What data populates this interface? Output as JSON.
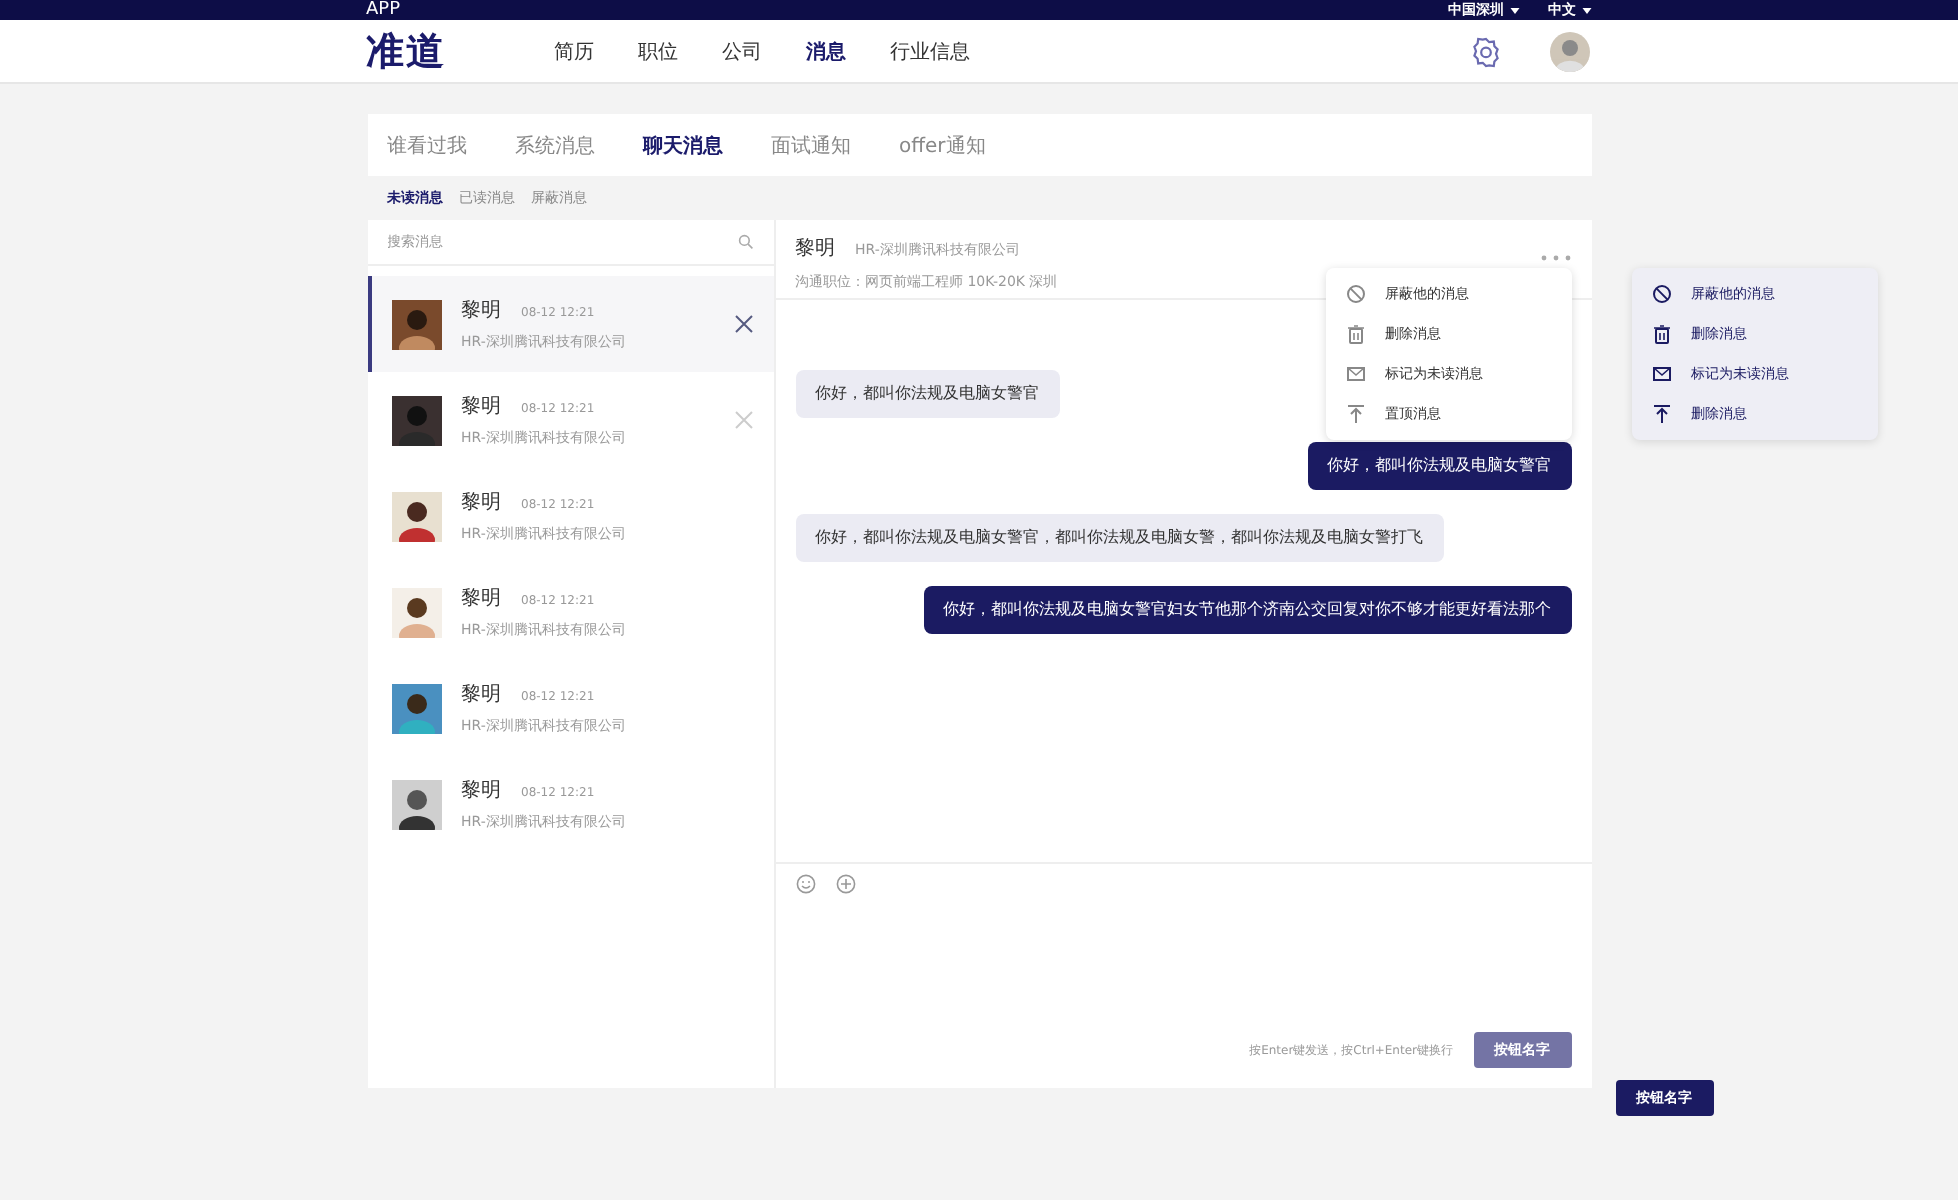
{
  "top_bar": {
    "app_label": "APP",
    "region": "中国深圳",
    "language": "中文"
  },
  "header": {
    "logo": "准道",
    "nav": [
      {
        "label": "简历",
        "selected": false
      },
      {
        "label": "职位",
        "selected": false
      },
      {
        "label": "公司",
        "selected": false
      },
      {
        "label": "消息",
        "selected": true
      },
      {
        "label": "行业信息",
        "selected": false
      }
    ]
  },
  "tabs": [
    {
      "label": "谁看过我",
      "selected": false
    },
    {
      "label": "系统消息",
      "selected": false
    },
    {
      "label": "聊天消息",
      "selected": true
    },
    {
      "label": "面试通知",
      "selected": false
    },
    {
      "label": "offer通知",
      "selected": false
    }
  ],
  "sub_tabs": [
    {
      "label": "未读消息",
      "selected": true
    },
    {
      "label": "已读消息",
      "selected": false
    },
    {
      "label": "屏蔽消息",
      "selected": false
    }
  ],
  "search": {
    "placeholder": "搜索消息"
  },
  "conversations": [
    {
      "name": "黎明",
      "time": "08-12 12:21",
      "company": "HR-深圳腾讯科技有限公司",
      "selected": true,
      "close_visible": true
    },
    {
      "name": "黎明",
      "time": "08-12 12:21",
      "company": "HR-深圳腾讯科技有限公司",
      "selected": false,
      "close_visible": true
    },
    {
      "name": "黎明",
      "time": "08-12 12:21",
      "company": "HR-深圳腾讯科技有限公司",
      "selected": false,
      "close_visible": false
    },
    {
      "name": "黎明",
      "time": "08-12 12:21",
      "company": "HR-深圳腾讯科技有限公司",
      "selected": false,
      "close_visible": false
    },
    {
      "name": "黎明",
      "time": "08-12 12:21",
      "company": "HR-深圳腾讯科技有限公司",
      "selected": false,
      "close_visible": false
    },
    {
      "name": "黎明",
      "time": "08-12 12:21",
      "company": "HR-深圳腾讯科技有限公司",
      "selected": false,
      "close_visible": false
    }
  ],
  "chat": {
    "name": "黎明",
    "company": "HR-深圳腾讯科技有限公司",
    "position": "沟通职位：网页前端工程师 10K-20K 深圳",
    "menu": [
      {
        "label": "屏蔽他的消息",
        "kind": "block"
      },
      {
        "label": "删除消息",
        "kind": "trash"
      },
      {
        "label": "标记为未读消息",
        "kind": "mail"
      },
      {
        "label": "置顶消息",
        "kind": "top"
      }
    ],
    "messages": [
      {
        "text": "你好，都叫你法规及电脑女警官",
        "kind": "received"
      },
      {
        "text": "你好，都叫你法规及电脑女警官",
        "kind": "sent"
      },
      {
        "text": "你好，都叫你法规及电脑女警官，都叫你法规及电脑女警，都叫你法规及电脑女警打飞",
        "kind": "received"
      },
      {
        "text": "你好，都叫你法规及电脑女警官妇女节他那个济南公交回复对你不够才能更好看法那个",
        "kind": "sent"
      }
    ],
    "hint": "按Enter键发送，按Ctrl+Enter键换行",
    "send_button": {
      "label": "按钮名字",
      "disabled": true
    }
  },
  "side_menu": [
    {
      "label": "屏蔽他的消息",
      "kind": "block"
    },
    {
      "label": "删除消息",
      "kind": "trash"
    },
    {
      "label": "标记为未读消息",
      "kind": "mail"
    },
    {
      "label": "删除消息",
      "kind": "top"
    }
  ],
  "side_button": {
    "label": "按钮名字",
    "disabled": false
  }
}
